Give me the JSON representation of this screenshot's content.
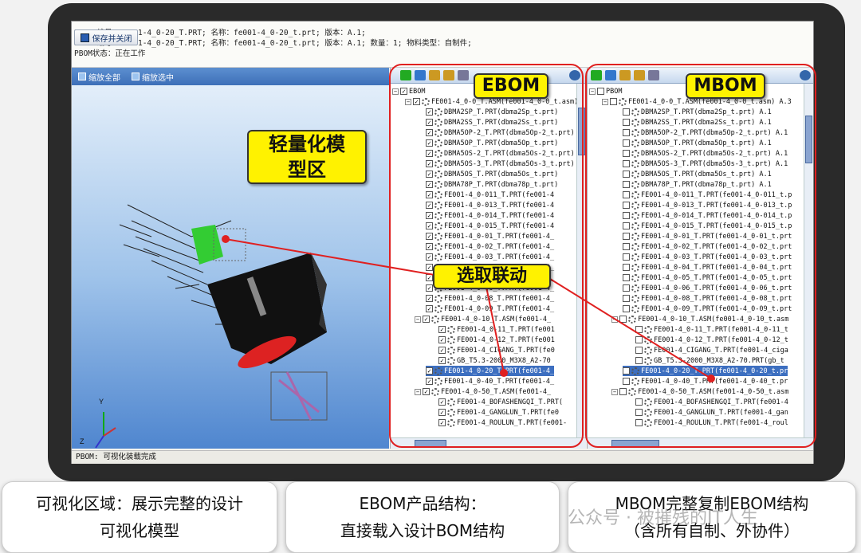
{
  "info": {
    "line1": "EBOM:编号：FE001-4_0-20_T.PRT;  名称：fe001-4_0-20_t.prt;  版本：A.1;",
    "line2": "PBOM:编号：FE001-4_0-20_T.PRT;  名称：fe001-4_0-20_t.prt;  版本：A.1;  数量：1;  物料类型：自制件;",
    "line3": "PBOM状态：正在工作",
    "save_button": "保存并关闭"
  },
  "viewer": {
    "fit_all": "缩放全部",
    "fit_selected": "缩放选中",
    "label": "轻量化模型区",
    "axis_y": "Y",
    "axis_z": "Z"
  },
  "status": "PBOM: 可视化装载完成",
  "ebom": {
    "label": "EBOM",
    "root": "EBOM",
    "assembly": "FE001-4_0-0_T.ASM(fe001-4_0-0_t.asm)",
    "items": [
      "DBMA2SP_T.PRT(dbma2Sp_t.prt)",
      "DBMA2SS_T.PRT(dbma2Ss_t.prt)",
      "DBMA5OP-2_T.PRT(dbma5Op-2_t.prt)",
      "DBMA5OP_T.PRT(dbma5Op_t.prt)",
      "DBMA5OS-2_T.PRT(dbma5Os-2_t.prt)",
      "DBMA5OS-3_T.PRT(dbma5Os-3_t.prt)",
      "DBMA5OS_T.PRT(dbma5Os_t.prt)",
      "DBMA78P_T.PRT(dbma78p_t.prt)",
      "FE001-4_0-011_T.PRT(fe001-4",
      "FE001-4_0-013_T.PRT(fe001-4",
      "FE001-4_0-014_T.PRT(fe001-4",
      "FE001-4_0-015_T.PRT(fe001-4",
      "FE001-4_0-01_T.PRT(fe001-4_",
      "FE001-4_0-02_T.PRT(fe001-4_",
      "FE001-4_0-03_T.PRT(fe001-4_",
      "FE001-4_0-04_T.PRT(fe001-4_",
      "FE001-4_0-05_T.PRT(fe001-4_",
      "FE001-4_0-06_T.PRT(fe001-4_",
      "FE001-4_0-08_T.PRT(fe001-4_",
      "FE001-4_0-09_T.PRT(fe001-4_",
      "FE001-4_0-10_T.ASM(fe001-4_"
    ],
    "sub10": [
      "FE001-4_0-11_T.PRT(fe001",
      "FE001-4_0-12_T.PRT(fe001",
      "FE001-4_CIGANG_T.PRT(fe0",
      "GB_T5.3-2000_M3X8_A2-70"
    ],
    "selected": "FE001-4_0-20_T.PRT(fe001-4_",
    "after": [
      "FE001-4_0-40_T.PRT(fe001-4_",
      "FE001-4_0-50_T.ASM(fe001-4_"
    ],
    "sub50": [
      "FE001-4_BOFASHENGQI_T.PRT(",
      "FE001-4_GANGLUN_T.PRT(fe0",
      "FE001-4_ROULUN_T.PRT(fe001-"
    ]
  },
  "mbom": {
    "label": "MBOM",
    "root": "PBOM",
    "assembly": "FE001-4_0-0_T.ASM(fe001-4_0-0_t.asm) A.3",
    "items": [
      "DBMA2SP_T.PRT(dbma2Sp_t.prt) A.1",
      "DBMA2SS_T.PRT(dbma2Ss_t.prt) A.1",
      "DBMA5OP-2_T.PRT(dbma5Op-2_t.prt) A.1",
      "DBMA5OP_T.PRT(dbma5Op_t.prt) A.1",
      "DBMA5OS-2_T.PRT(dbma5Os-2_t.prt) A.1",
      "DBMA5OS-3_T.PRT(dbma5Os-3_t.prt) A.1",
      "DBMA5OS_T.PRT(dbma5Os_t.prt) A.1",
      "DBMA78P_T.PRT(dbma78p_t.prt) A.1",
      "FE001-4_0-011_T.PRT(fe001-4_0-011_t.p",
      "FE001-4_0-013_T.PRT(fe001-4_0-013_t.p",
      "FE001-4_0-014_T.PRT(fe001-4_0-014_t.p",
      "FE001-4_0-015_T.PRT(fe001-4_0-015_t.p",
      "FE001-4_0-01_T.PRT(fe001-4_0-01_t.prt",
      "FE001-4_0-02_T.PRT(fe001-4_0-02_t.prt",
      "FE001-4_0-03_T.PRT(fe001-4_0-03_t.prt",
      "FE001-4_0-04_T.PRT(fe001-4_0-04_t.prt",
      "FE001-4_0-05_T.PRT(fe001-4_0-05_t.prt",
      "FE001-4_0-06_T.PRT(fe001-4_0-06_t.prt",
      "FE001-4_0-08_T.PRT(fe001-4_0-08_t.prt",
      "FE001-4_0-09_T.PRT(fe001-4_0-09_t.prt",
      "FE001-4_0-10_T.ASM(fe001-4_0-10_t.asm"
    ],
    "sub10": [
      "FE001-4_0-11_T.PRT(fe001-4_0-11_t",
      "FE001-4_0-12_T.PRT(fe001-4_0-12_t",
      "FE001-4_CIGANG_T.PRT(fe001-4_ciga",
      "GB_T5.3-2000_M3X8_A2-70.PRT(gb_t"
    ],
    "selected": "FE001-4_0-20_T.PRT(fe001-4_0-20_t.pr",
    "after": [
      "FE001-4_0-40_T.PRT(fe001-4_0-40_t.pr",
      "FE001-4_0-50_T.ASM(fe001-4_0-50_t.asm"
    ],
    "sub50": [
      "FE001-4_BOFASHENGQI_T.PRT(fe001-4",
      "FE001-4_GANGLUN_T.PRT(fe001-4_gan",
      "FE001-4_ROULUN_T.PRT(fe001-4_roul"
    ]
  },
  "link_label": "选取联动",
  "captions": {
    "left_1": "可视化区域：展示完整的设计",
    "left_2": "可视化模型",
    "mid_1": "EBOM产品结构：",
    "mid_2": "直接载入设计BOM结构",
    "right_1": "MBOM完整复制EBOM结构",
    "right_2": "（含所有自制、外协件）"
  },
  "watermark": "公众号 · 被摧残的IT人生",
  "colors": {
    "highlight": "#fff200",
    "callout": "#e02020",
    "selection": "#3d6fc0"
  }
}
